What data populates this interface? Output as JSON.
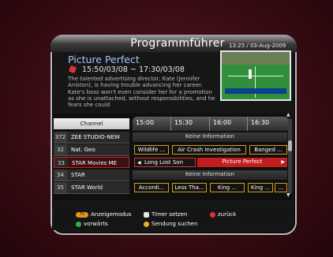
{
  "header": {
    "title": "Programmführer",
    "datetime": "13:25 / 03-Aug-2009"
  },
  "program": {
    "title": "Picture Perfect",
    "time": "15:50/03/08 ~ 17:30/03/08",
    "description": "The talented advertising director, Kate (Jennifer Aniston), is having trouble advancing her career. Kate's boss won't even consider her for a promotion as she is unattached, without responsibilities, and he fears she could"
  },
  "grid": {
    "channel_header": "Channel",
    "time_slots": [
      "15:00",
      "15:30",
      "16:00",
      "16:30"
    ],
    "channels": [
      {
        "num": "372",
        "name": "ZEE STUDIO-NEW"
      },
      {
        "num": "32",
        "name": "Nat. Geo"
      },
      {
        "num": "33",
        "name": "STAR Movies ME"
      },
      {
        "num": "34",
        "name": "STAR"
      },
      {
        "num": "35",
        "name": "STAR World"
      }
    ],
    "rows": [
      {
        "info": "Keine Information"
      },
      {
        "cells": [
          "Wildlife ...",
          "Air Crash Investigation",
          "Banged ..."
        ]
      },
      {
        "cells": [
          "Long Lost Son",
          "Picture Perfect"
        ]
      },
      {
        "info": "Keine Information"
      },
      {
        "cells": [
          "Accordi...",
          "Less Tha...",
          "King ...",
          "King ...",
          "..."
        ]
      }
    ]
  },
  "footer": {
    "items": [
      {
        "label": "Anzeigemodus",
        "pill_label": "TV",
        "icon": "pill-button-icon",
        "color": "#e5931f"
      },
      {
        "label": "Timer setzen",
        "icon": "white-button-icon",
        "color": "#e5e5e5"
      },
      {
        "label": "zurück",
        "icon": "red-button-icon",
        "color": "#d8323a"
      },
      {
        "label": "vorwärts",
        "icon": "green-button-icon",
        "color": "#2fb04a"
      },
      {
        "label": "Sendung suchen",
        "icon": "yellow-button-icon",
        "color": "#e5b324"
      }
    ]
  },
  "colors": {
    "selected_row": "#c21e1e",
    "cell_border": "#d79a1d",
    "title_accent": "#9ec7ff"
  }
}
